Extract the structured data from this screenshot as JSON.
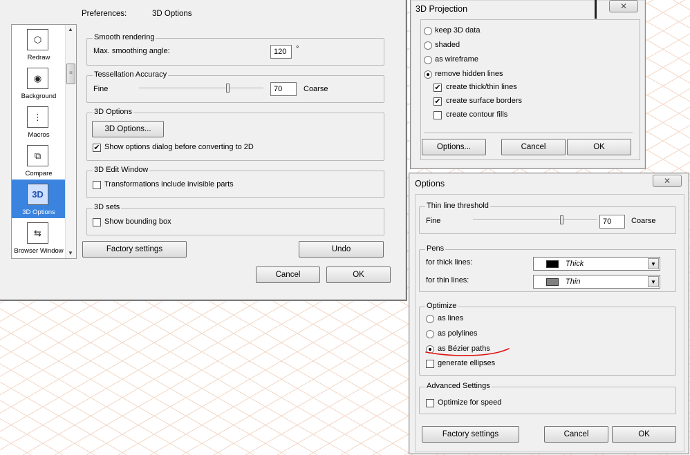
{
  "prefs": {
    "breadcrumb": "Preferences:",
    "section": "3D Options",
    "sidebar": [
      {
        "label": "Redraw",
        "icon": "redraw-icon",
        "glyph": "⬡"
      },
      {
        "label": "Background",
        "icon": "background-icon",
        "glyph": "◉"
      },
      {
        "label": "Macros",
        "icon": "macros-icon",
        "glyph": "⋮"
      },
      {
        "label": "Compare",
        "icon": "compare-icon",
        "glyph": "⧉"
      },
      {
        "label": "3D Options",
        "icon": "3d-options-icon",
        "glyph": "3D"
      },
      {
        "label": "Browser Window",
        "icon": "browser-window-icon",
        "glyph": "⇆"
      }
    ],
    "smooth": {
      "legend": "Smooth rendering",
      "label": "Max. smoothing angle:",
      "value": "120",
      "unit": "°"
    },
    "tess": {
      "legend": "Tessellation Accuracy",
      "fine": "Fine",
      "coarse": "Coarse",
      "value": "70",
      "level": 0.72
    },
    "opts3d": {
      "legend": "3D Options",
      "button": "3D Options...",
      "check_label": "Show options dialog before converting to 2D",
      "checked": true
    },
    "edit": {
      "legend": "3D Edit Window",
      "check_label": "Transformations include invisible parts",
      "checked": false
    },
    "sets": {
      "legend": "3D sets",
      "check_label": "Show bounding box",
      "checked": false
    },
    "factory": "Factory settings",
    "undo": "Undo",
    "cancel": "Cancel",
    "ok": "OK"
  },
  "proj": {
    "title": "3D Projection",
    "close": "✕",
    "radios": [
      {
        "label": "keep 3D data",
        "selected": false
      },
      {
        "label": "shaded",
        "selected": false
      },
      {
        "label": "as wireframe",
        "selected": false
      },
      {
        "label": "remove hidden lines",
        "selected": true
      }
    ],
    "checks": [
      {
        "label": "create thick/thin lines",
        "checked": true
      },
      {
        "label": "create surface borders",
        "checked": true
      },
      {
        "label": "create contour fills",
        "checked": false
      }
    ],
    "options_btn": "Options...",
    "cancel": "Cancel",
    "ok": "OK"
  },
  "options": {
    "title": "Options",
    "close": "✕",
    "thin": {
      "legend": "Thin line threshold",
      "fine": "Fine",
      "coarse": "Coarse",
      "value": "70",
      "level": 0.72
    },
    "pens": {
      "legend": "Pens",
      "thick_label": "for thick lines:",
      "thick_value": "Thick",
      "thick_color": "#000000",
      "thin_label": "for thin lines:",
      "thin_value": "Thin",
      "thin_color": "#808080"
    },
    "optimize": {
      "legend": "Optimize",
      "radios": [
        {
          "label": "as lines",
          "selected": false
        },
        {
          "label": "as polylines",
          "selected": false
        },
        {
          "label": "as Bézier paths",
          "selected": true
        }
      ],
      "ellipse_label": "generate ellipses",
      "ellipse_checked": false
    },
    "advanced": {
      "legend": "Advanced Settings",
      "check_label": "Optimize for speed",
      "checked": false
    },
    "factory": "Factory settings",
    "cancel": "Cancel",
    "ok": "OK",
    "annotation_color": "#e01010"
  }
}
